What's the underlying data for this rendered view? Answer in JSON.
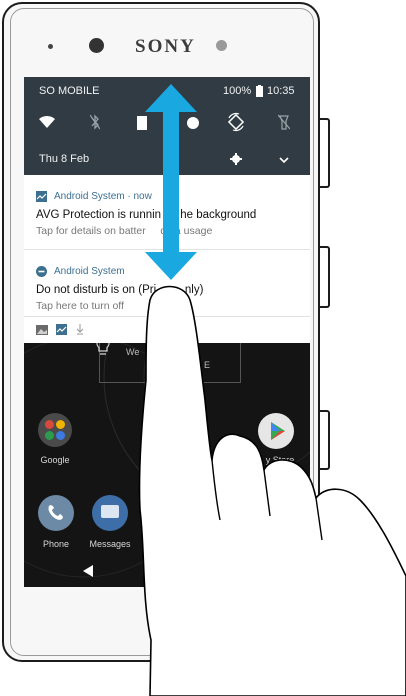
{
  "device": {
    "brand": "SONY"
  },
  "status_bar": {
    "carrier": "SO MOBILE",
    "battery": "100%",
    "time": "10:35"
  },
  "quick_settings": {
    "date": "Thu 8 Feb",
    "tiles": [
      "wifi-icon",
      "bluetooth-off-icon",
      "flashlight-icon",
      "night-light-icon",
      "auto-rotate-icon",
      "flashlight-off-icon"
    ]
  },
  "notifications": [
    {
      "app": "Android System · now",
      "title": "AVG Protection is runnin      he background",
      "subtitle": "Tap for details on batter     data usage"
    },
    {
      "app": "Android System",
      "title": "Do not disturb is on (Pri         nly)",
      "subtitle": "Tap here to turn off"
    }
  ],
  "home": {
    "widget_text_1": "We          meria",
    "widget_text_2": "E",
    "apps": [
      {
        "label": "Google"
      },
      {
        "label": "y Store"
      },
      {
        "label": "Phone"
      },
      {
        "label": "Messages"
      }
    ]
  },
  "colors": {
    "quick_settings_bg": "#303b43",
    "arrow": "#1aa8e0",
    "notif_accent": "#3d6f8f"
  }
}
